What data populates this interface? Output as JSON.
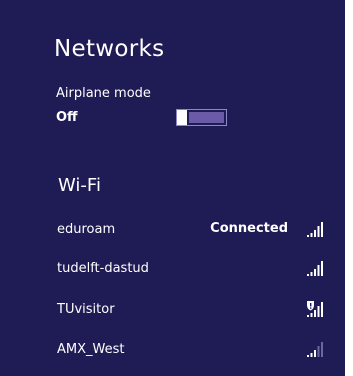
{
  "header": {
    "title": "Networks"
  },
  "airplane_mode": {
    "label": "Airplane mode",
    "state": "Off",
    "value": 0
  },
  "wifi": {
    "section_label": "Wi-Fi",
    "networks": [
      {
        "name": "eduroam",
        "status": "Connected",
        "signal_bars": 5,
        "secured_shield": false
      },
      {
        "name": "tudelft-dastud",
        "status": "",
        "signal_bars": 5,
        "secured_shield": false
      },
      {
        "name": "TUvisitor",
        "status": "",
        "signal_bars": 5,
        "secured_shield": true
      },
      {
        "name": "AMX_West",
        "status": "",
        "signal_bars": 3,
        "secured_shield": false
      }
    ]
  },
  "colors": {
    "background": "#1f1b55",
    "toggle_accent": "#6b5aa8",
    "text": "#ffffff",
    "bar_dim": "#6a66a0"
  },
  "icons": {
    "signal": "wifi-signal-icon",
    "shield": "shield-icon"
  }
}
